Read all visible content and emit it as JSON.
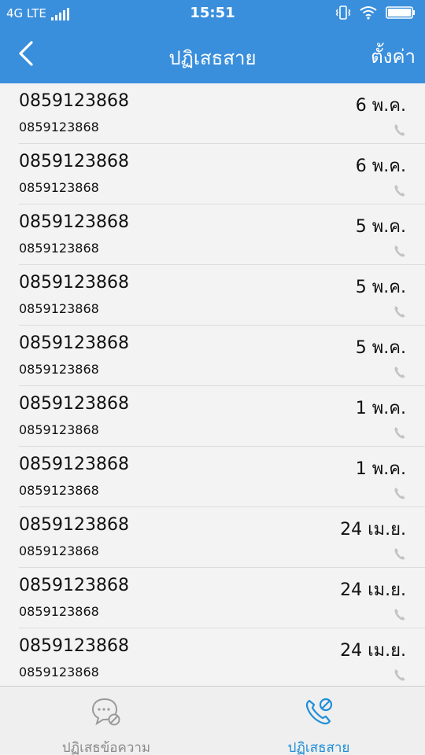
{
  "status_bar": {
    "network": "4G LTE",
    "time": "15:51"
  },
  "header": {
    "title": "ปฏิเสธสาย",
    "settings_label": "ตั้งค่า"
  },
  "calls": [
    {
      "number": "0859123868",
      "subtitle": "0859123868",
      "date": "6 พ.ค."
    },
    {
      "number": "0859123868",
      "subtitle": "0859123868",
      "date": "6 พ.ค."
    },
    {
      "number": "0859123868",
      "subtitle": "0859123868",
      "date": "5 พ.ค."
    },
    {
      "number": "0859123868",
      "subtitle": "0859123868",
      "date": "5 พ.ค."
    },
    {
      "number": "0859123868",
      "subtitle": "0859123868",
      "date": "5 พ.ค."
    },
    {
      "number": "0859123868",
      "subtitle": "0859123868",
      "date": "1 พ.ค."
    },
    {
      "number": "0859123868",
      "subtitle": "0859123868",
      "date": "1 พ.ค."
    },
    {
      "number": "0859123868",
      "subtitle": "0859123868",
      "date": "24 เม.ย."
    },
    {
      "number": "0859123868",
      "subtitle": "0859123868",
      "date": "24 เม.ย."
    },
    {
      "number": "0859123868",
      "subtitle": "0859123868",
      "date": "24 เม.ย."
    }
  ],
  "tabs": [
    {
      "label": "ปฏิเสธข้อความ",
      "icon": "message-blocked-icon",
      "active": false
    },
    {
      "label": "ปฏิเสธสาย",
      "icon": "phone-blocked-icon",
      "active": true
    }
  ],
  "colors": {
    "header_bg": "#3a8fdc",
    "active_tab": "#1f8ed8",
    "inactive_tab": "#8a8a8a"
  }
}
